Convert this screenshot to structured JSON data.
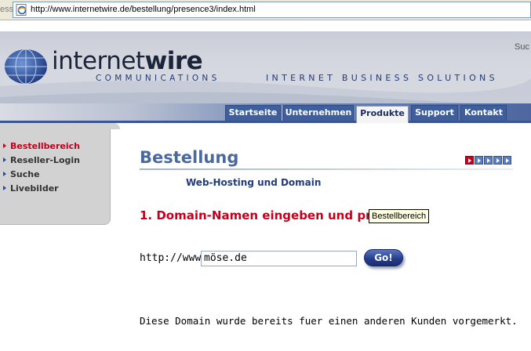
{
  "browser": {
    "left_label": "ess",
    "url": "http://www.internetwire.de/bestellung/presence3/index.html"
  },
  "header": {
    "brand_part1": "internet",
    "brand_part2": "wire",
    "brand_sub": "COMMUNICATIONS",
    "tagline": "INTERNET BUSINESS SOLUTIONS",
    "corner_text": "Suc"
  },
  "nav_tabs": [
    {
      "label": "Startseite"
    },
    {
      "label": "Unternehmen"
    },
    {
      "label": "Produkte",
      "active": true
    },
    {
      "label": "Support"
    },
    {
      "label": "Kontakt"
    }
  ],
  "sidebar": {
    "items": [
      {
        "label": "Bestellbereich",
        "active": true
      },
      {
        "label": "Reseller-Login"
      },
      {
        "label": "Suche"
      },
      {
        "label": "Livebilder"
      }
    ]
  },
  "main": {
    "title": "Bestellung",
    "subtitle": "Web-Hosting und Domain",
    "step_heading": "1. Domain-Namen eingeben und prüfe",
    "tooltip": "Bestellbereich",
    "url_prefix": "http://www.",
    "domain_value": "möse.de",
    "go_label": "Go!",
    "message": "Diese Domain wurde bereits fuer einen anderen Kunden vorgemerkt."
  },
  "colors": {
    "accent_blue": "#3e5e9c",
    "active_red": "#c4001e",
    "title_blue": "#4a6a9e"
  }
}
